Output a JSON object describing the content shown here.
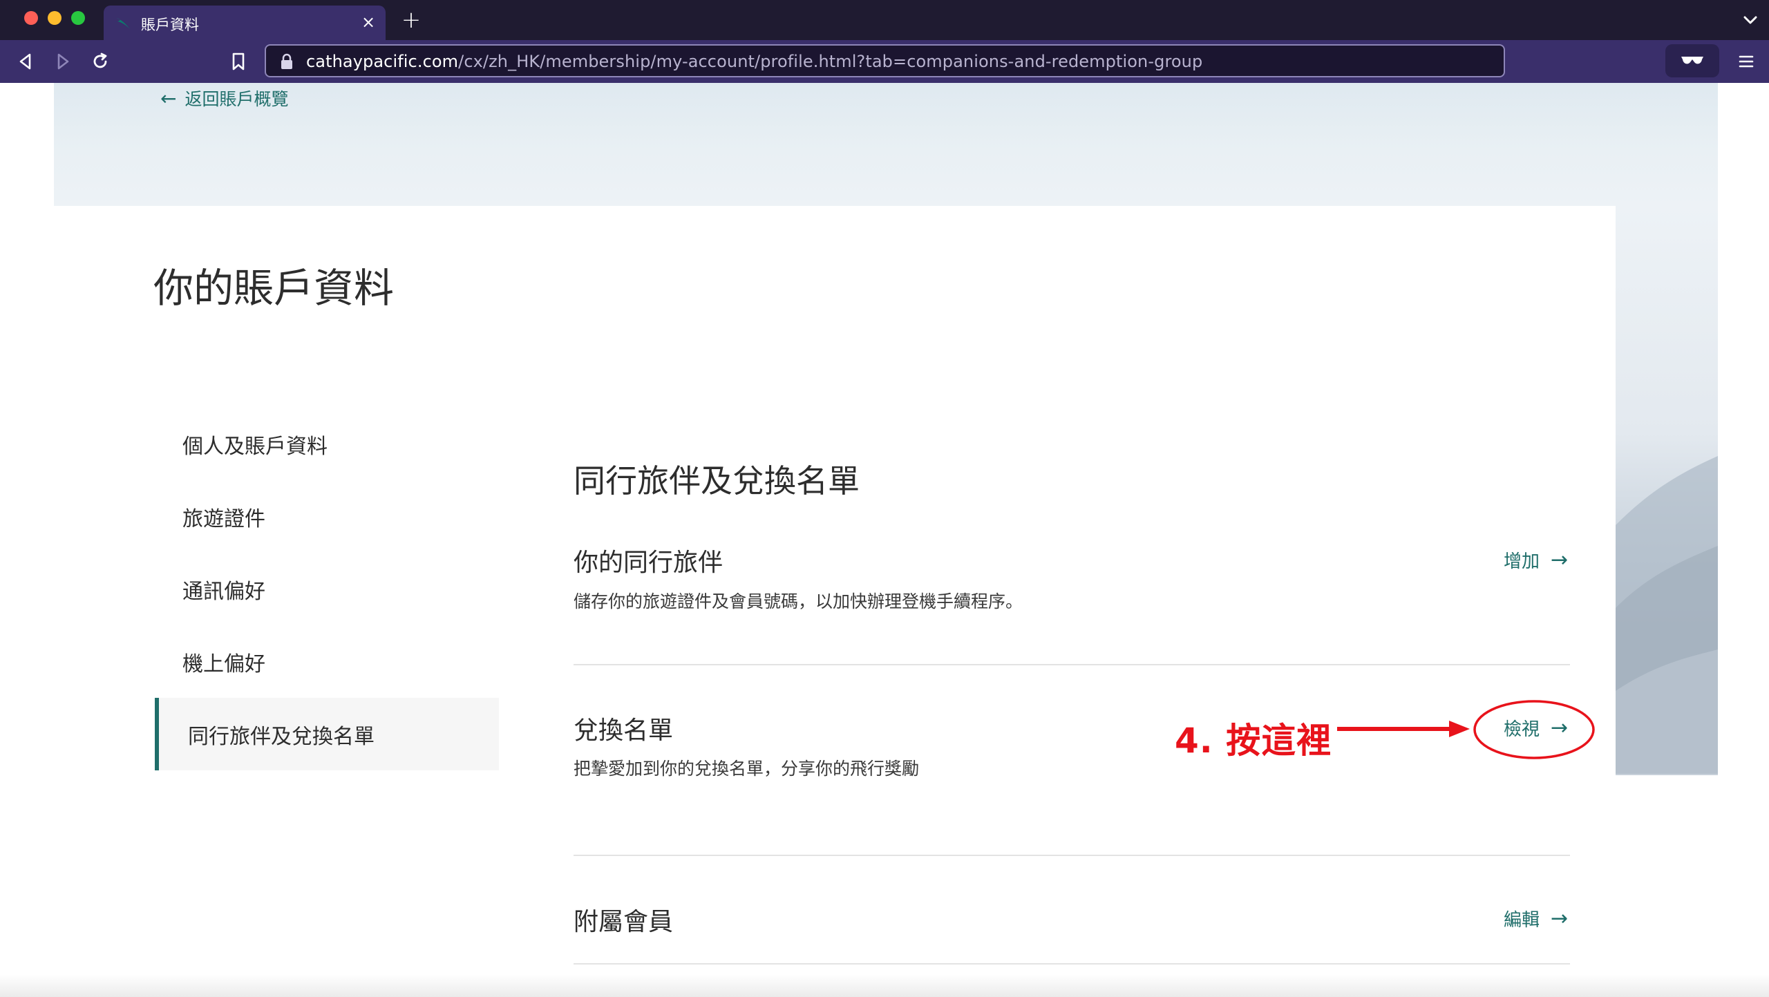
{
  "browser": {
    "tab_title": "賬戶資料",
    "tab_close_glyph": "×",
    "new_tab_glyph": "+",
    "url_host": "cathaypacific.com",
    "url_path": "/cx/zh_HK/membership/my-account/profile.html?tab=companions-and-redemption-group"
  },
  "page": {
    "back_link": "返回賬戶概覽",
    "back_arrow": "←",
    "title": "你的賬戶資料"
  },
  "sidebar": {
    "items": [
      {
        "label": "個人及賬戶資料",
        "active": false
      },
      {
        "label": "旅遊證件",
        "active": false
      },
      {
        "label": "通訊偏好",
        "active": false
      },
      {
        "label": "機上偏好",
        "active": false
      },
      {
        "label": "同行旅伴及兌換名單",
        "active": true
      }
    ]
  },
  "content": {
    "section_title": "同行旅伴及兌換名單",
    "companions": {
      "title": "你的同行旅伴",
      "description": "儲存你的旅遊證件及會員號碼，以加快辦理登機手續程序。",
      "action": "增加",
      "arrow": "→"
    },
    "redemption_group": {
      "title": "兌換名單",
      "description": "把摯愛加到你的兌換名單，分享你的飛行獎勵",
      "action": "檢視",
      "arrow": "→"
    },
    "supplementary": {
      "title": "附屬會員",
      "action": "編輯",
      "arrow": "→"
    }
  },
  "annotation": {
    "text": "4. 按這裡",
    "color": "#e8131b"
  },
  "colors": {
    "brand_teal": "#1f6e6a",
    "chrome_purple": "#3a2f6b",
    "tabbar_dark": "#1f1b31"
  }
}
